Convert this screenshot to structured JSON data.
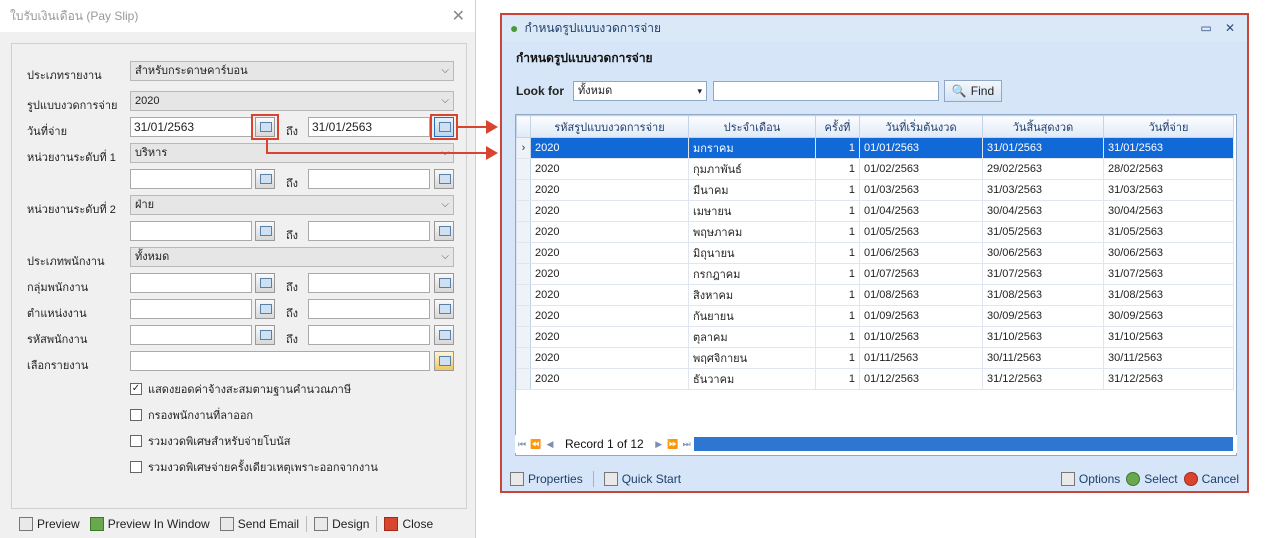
{
  "left_dialog": {
    "title": "ใบรับเงินเดือน (Pay Slip)",
    "labels": {
      "report_type": "ประเภทรายงาน",
      "pay_period_format": "รูปแบบงวดการจ่าย",
      "pay_date": "วันที่จ่าย",
      "unit_level1": "หน่วยงานระดับที่ 1",
      "unit_level2": "หน่วยงานระดับที่ 2",
      "employee_type": "ประเภทพนักงาน",
      "employee_group": "กลุ่มพนักงาน",
      "position": "ตำแหน่งงาน",
      "employee_code": "รหัสพนักงาน",
      "select_report": "เลือกรายงาน",
      "to": "ถึง"
    },
    "values": {
      "report_type": "สำหรับกระดาษคาร์บอน",
      "pay_period_format": "2020",
      "pay_date_from": "31/01/2563",
      "pay_date_to": "31/01/2563",
      "unit_level1": "บริหาร",
      "unit_level2": "ฝ่าย",
      "employee_type": "ทั้งหมด"
    },
    "checkboxes": [
      {
        "label": "แสดงยอดค่าจ้างสะสมตามฐานคำนวณภาษี",
        "checked": true
      },
      {
        "label": "กรองพนักงานที่ลาออก",
        "checked": false
      },
      {
        "label": "รวมงวดพิเศษสำหรับจ่ายโบนัส",
        "checked": false
      },
      {
        "label": "รวมงวดพิเศษจ่ายครั้งเดียวเหตุเพราะออกจากงาน",
        "checked": false
      }
    ],
    "buttons": {
      "preview": "Preview",
      "preview_in_window": "Preview In Window",
      "send_email": "Send Email",
      "design": "Design",
      "close": "Close"
    }
  },
  "right_dialog": {
    "title": "กำหนดรูปแบบงวดการจ่าย",
    "header": "กำหนดรูปแบบงวดการจ่าย",
    "look_for_label": "Look for",
    "look_for_value": "ทั้งหมด",
    "search_value": "",
    "find_label": "Find",
    "columns": [
      "รหัสรูปแบบงวดการจ่าย",
      "ประจำเดือน",
      "ครั้งที่",
      "วันที่เริ่มต้นงวด",
      "วันสิ้นสุดงวด",
      "วันที่จ่าย"
    ],
    "rows": [
      [
        "2020",
        "มกราคม",
        "1",
        "01/01/2563",
        "31/01/2563",
        "31/01/2563"
      ],
      [
        "2020",
        "กุมภาพันธ์",
        "1",
        "01/02/2563",
        "29/02/2563",
        "28/02/2563"
      ],
      [
        "2020",
        "มีนาคม",
        "1",
        "01/03/2563",
        "31/03/2563",
        "31/03/2563"
      ],
      [
        "2020",
        "เมษายน",
        "1",
        "01/04/2563",
        "30/04/2563",
        "30/04/2563"
      ],
      [
        "2020",
        "พฤษภาคม",
        "1",
        "01/05/2563",
        "31/05/2563",
        "31/05/2563"
      ],
      [
        "2020",
        "มิถุนายน",
        "1",
        "01/06/2563",
        "30/06/2563",
        "30/06/2563"
      ],
      [
        "2020",
        "กรกฎาคม",
        "1",
        "01/07/2563",
        "31/07/2563",
        "31/07/2563"
      ],
      [
        "2020",
        "สิงหาคม",
        "1",
        "01/08/2563",
        "31/08/2563",
        "31/08/2563"
      ],
      [
        "2020",
        "กันยายน",
        "1",
        "01/09/2563",
        "30/09/2563",
        "30/09/2563"
      ],
      [
        "2020",
        "ตุลาคม",
        "1",
        "01/10/2563",
        "31/10/2563",
        "31/10/2563"
      ],
      [
        "2020",
        "พฤศจิกายน",
        "1",
        "01/11/2563",
        "30/11/2563",
        "30/11/2563"
      ],
      [
        "2020",
        "ธันวาคม",
        "1",
        "01/12/2563",
        "31/12/2563",
        "31/12/2563"
      ]
    ],
    "selected_row": 0,
    "record_text": "Record 1 of 12",
    "buttons": {
      "properties": "Properties",
      "quick_start": "Quick Start",
      "options": "Options",
      "select": "Select",
      "cancel": "Cancel"
    }
  },
  "colors": {
    "selection": "#1168d7",
    "highlight": "#d9442e",
    "dialog_bg": "#d6e5f7"
  }
}
